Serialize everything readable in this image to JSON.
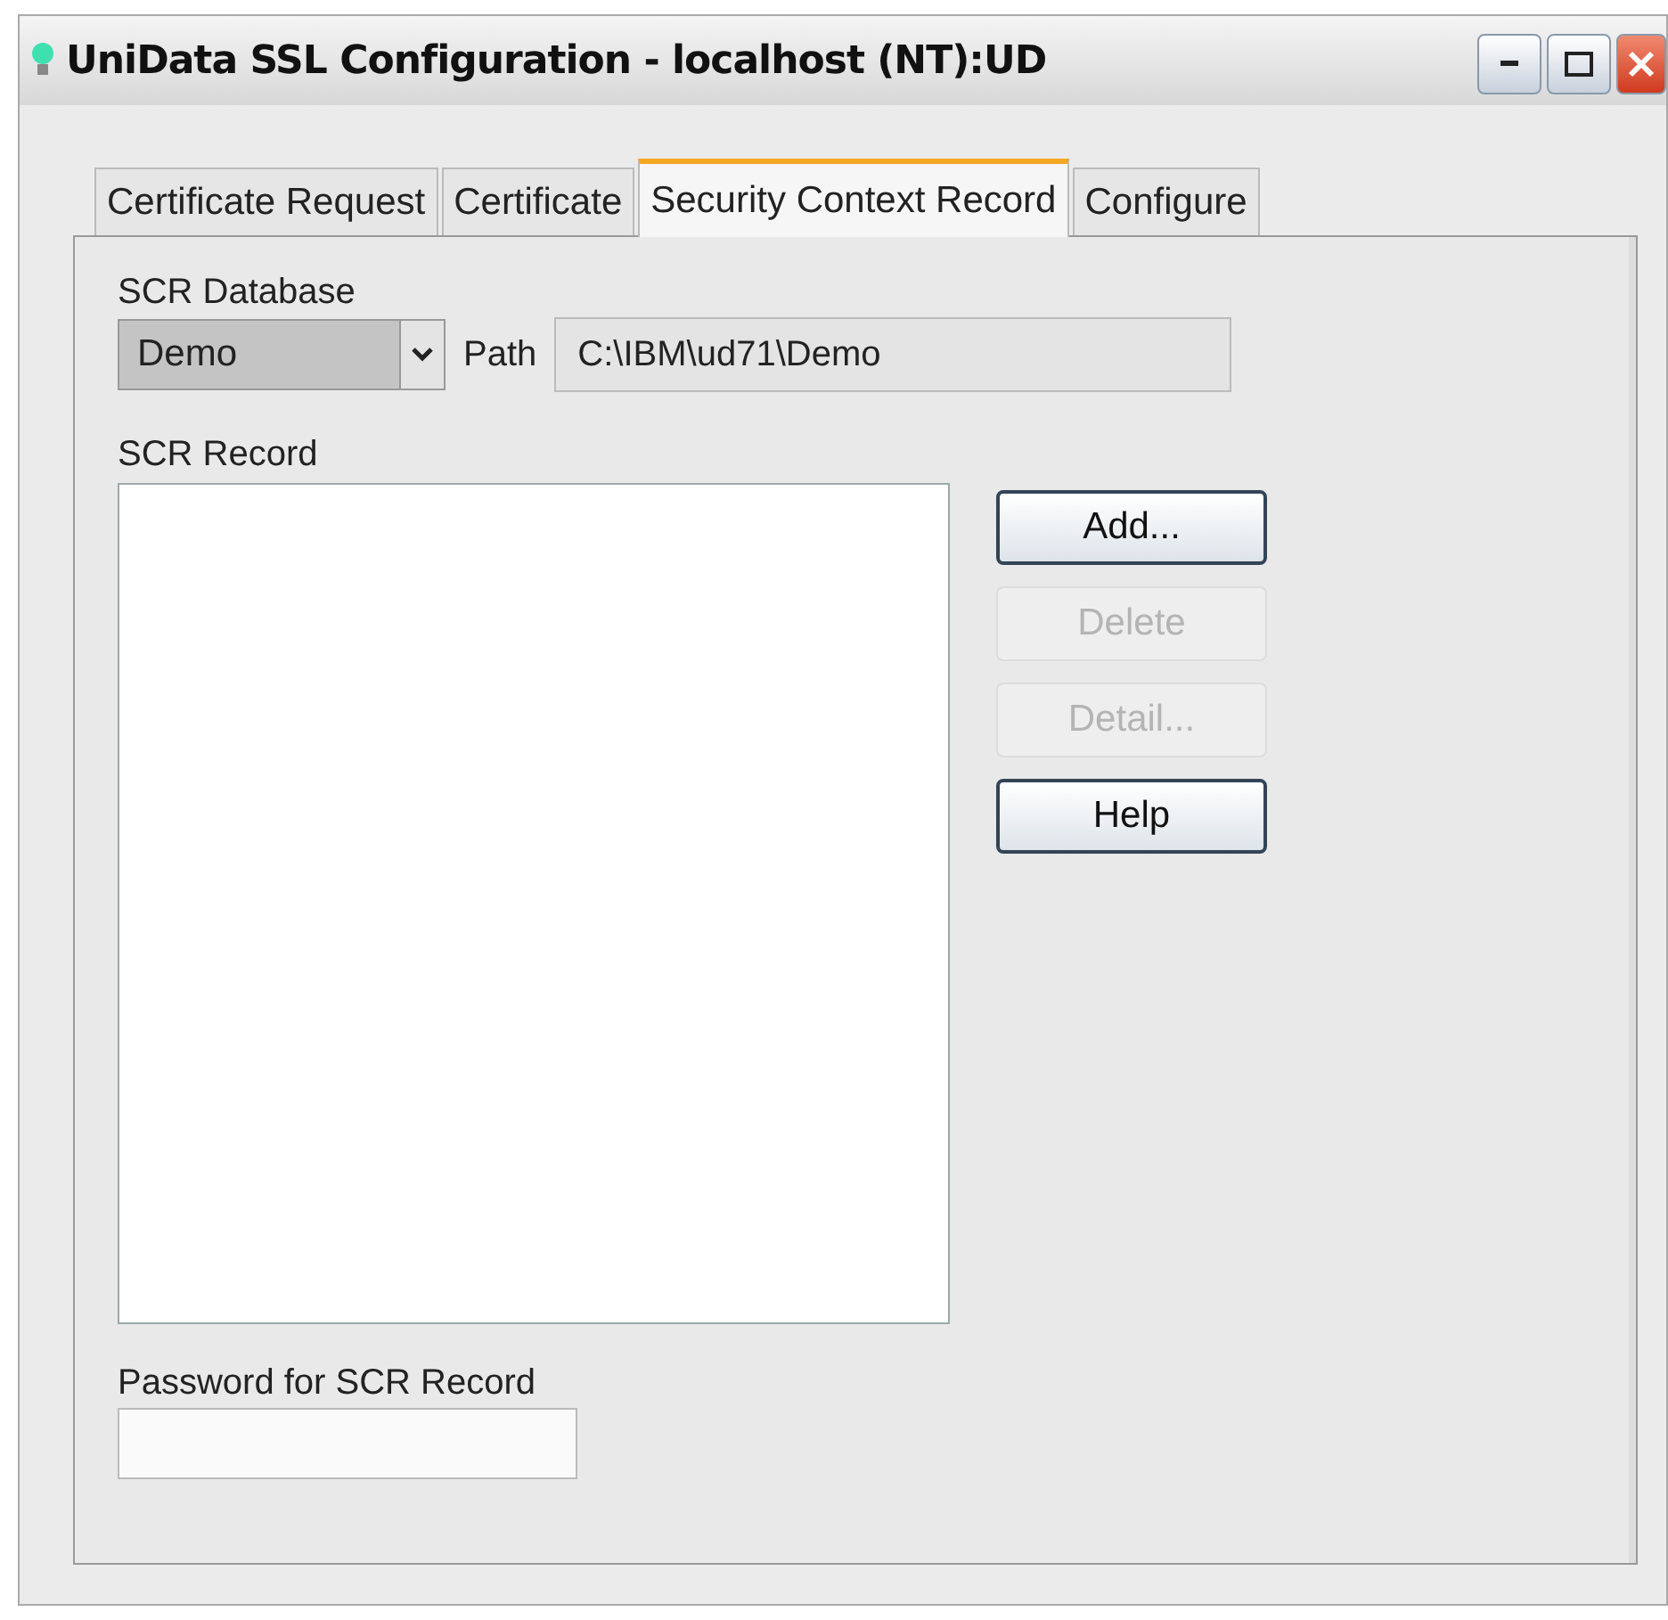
{
  "window": {
    "title": "UniData SSL Configuration - localhost (NT):UD"
  },
  "tabs": [
    {
      "label": "Certificate Request",
      "selected": false
    },
    {
      "label": "Certificate",
      "selected": false
    },
    {
      "label": "Security Context Record",
      "selected": true
    },
    {
      "label": "Configure",
      "selected": false
    }
  ],
  "scr_database": {
    "label": "SCR Database",
    "value": "Demo"
  },
  "path": {
    "label": "Path",
    "value": "C:\\IBM\\ud71\\Demo"
  },
  "scr_record": {
    "label": "SCR Record"
  },
  "buttons": [
    {
      "label": "Add...",
      "disabled": false
    },
    {
      "label": "Delete",
      "disabled": true
    },
    {
      "label": "Detail...",
      "disabled": true
    },
    {
      "label": "Help",
      "disabled": false
    }
  ],
  "password": {
    "label": "Password for SCR Record"
  }
}
